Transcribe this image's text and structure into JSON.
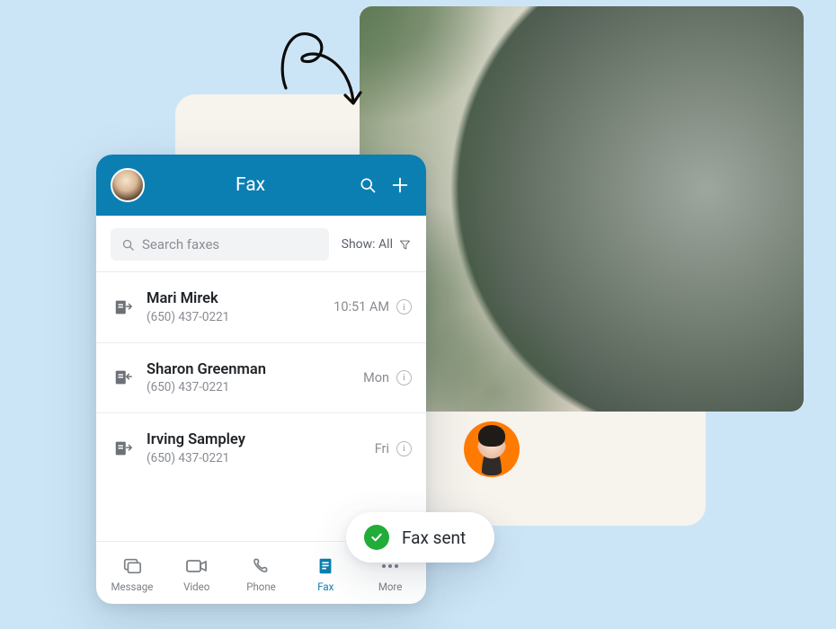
{
  "header": {
    "title": "Fax"
  },
  "search": {
    "placeholder": "Search faxes"
  },
  "filter": {
    "label": "Show: All"
  },
  "items": [
    {
      "name": "Mari Mirek",
      "phone": "(650) 437-0221",
      "time": "10:51 AM",
      "dir": "out"
    },
    {
      "name": "Sharon Greenman",
      "phone": "(650) 437-0221",
      "time": "Mon",
      "dir": "in"
    },
    {
      "name": "Irving Sampley",
      "phone": "(650) 437-0221",
      "time": "Fri",
      "dir": "out"
    }
  ],
  "tabs": [
    {
      "label": "Message"
    },
    {
      "label": "Video"
    },
    {
      "label": "Phone"
    },
    {
      "label": "Fax"
    },
    {
      "label": "More"
    }
  ],
  "toast": {
    "text": "Fax sent"
  }
}
